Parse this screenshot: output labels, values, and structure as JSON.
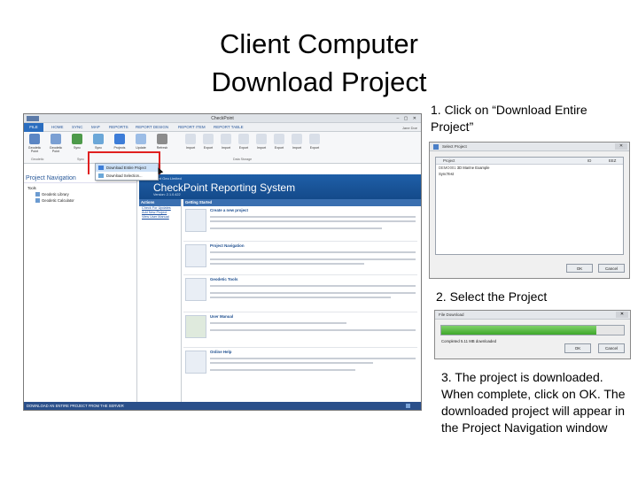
{
  "slide_title_line1": "Client Computer",
  "slide_title_line2": "Download Project",
  "steps": {
    "step1": "1. Click on “Download Entire Project”",
    "step2": "2. Select the Project",
    "step3": "3. The project is downloaded. When complete, click on OK. The downloaded project will appear in the Project Navigation window"
  },
  "app": {
    "window_title": "CheckPoint",
    "tabs": [
      "FILE",
      "HOME",
      "SYNC",
      "MAP",
      "REPORTS",
      "REPORT DESIGN",
      "REPORT ITEM",
      "REPORT TABLE"
    ],
    "user_label": "Jane Doe",
    "ribbon_buttons": [
      "Geodetic Point",
      "Geodetic Point",
      "Sync",
      "Sync",
      "Projects",
      "Update",
      "Refresh",
      "",
      "",
      "Import",
      "Export",
      "Import",
      "Export",
      "Import",
      "Export",
      "Import",
      "Export"
    ],
    "ribbon_groups": [
      "Geodetic",
      "Sync",
      "Data Storage"
    ],
    "dropdown_items": [
      "Download Entire Project",
      "Download Selection..."
    ],
    "nav_header": "Project Navigation",
    "tree": [
      "Tools",
      "Geodetic Library",
      "Geodetic Calculator"
    ],
    "banner_company": "Point Geo Limited",
    "banner_title": "CheckPoint Reporting System",
    "banner_version": "Version: 2.1.0.422",
    "actions_header": "Actions",
    "actions_links": [
      "Check For Updates",
      "Add New Project",
      "View User Manual"
    ],
    "getting_started_header": "Getting Started",
    "sections": [
      "Create a new project",
      "Project Navigation",
      "Geodetic Tools",
      "User Manual",
      "Online Help"
    ],
    "status_text": "DOWNLOAD AN ENTIRE PROJECT FROM THE SERVER"
  },
  "select_dialog": {
    "title": "Select Project",
    "columns": [
      "Project",
      "ID",
      "EEZ"
    ],
    "rows": [
      {
        "tag": "DEMO001",
        "name": "3D Marine Example"
      },
      {
        "tag": "",
        "name": "SyncTest"
      }
    ],
    "ok_label": "OK",
    "cancel_label": "Cancel"
  },
  "download_dialog": {
    "title": "File Download",
    "progress_fraction": 0.85,
    "message": "Completed 5.11 MB downloaded",
    "ok_label": "OK",
    "cancel_label": "Cancel"
  },
  "colors": {
    "accent": "#2a6dbf",
    "highlight_box": "#e02020",
    "banner": "#1f5fa8",
    "progress": "#3ea82a"
  }
}
